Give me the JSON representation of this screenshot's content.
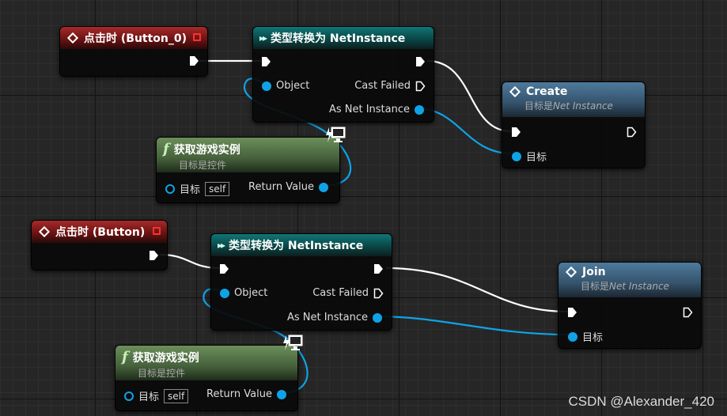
{
  "graph": {
    "group1": {
      "event_node": {
        "title": "点击时 (Button_0)"
      },
      "cast_node": {
        "title": "类型转换为 NetInstance",
        "object_pin": "Object",
        "cast_failed_pin": "Cast Failed",
        "as_pin": "As Net Instance"
      },
      "call_node": {
        "title": "Create",
        "subtitle_prefix": "目标是",
        "subtitle_class": "Net Instance",
        "target_pin": "目标"
      },
      "func_node": {
        "title": "获取游戏实例",
        "subtitle": "目标是控件",
        "target_pin": "目标",
        "self_value": "self",
        "return_pin": "Return Value"
      }
    },
    "group2": {
      "event_node": {
        "title": "点击时 (Button)"
      },
      "cast_node": {
        "title": "类型转换为 NetInstance",
        "object_pin": "Object",
        "cast_failed_pin": "Cast Failed",
        "as_pin": "As Net Instance"
      },
      "call_node": {
        "title": "Join",
        "subtitle_prefix": "目标是",
        "subtitle_class": "Net Instance",
        "target_pin": "目标"
      },
      "func_node": {
        "title": "获取游戏实例",
        "subtitle": "目标是控件",
        "target_pin": "目标",
        "self_value": "self",
        "return_pin": "Return Value"
      }
    }
  },
  "colors": {
    "exec_wire": "#ffffff",
    "data_wire": "#0fa3e6",
    "event_header": "#a62a2a",
    "cast_header": "#117676",
    "func_header": "#6b8e5a",
    "call_header": "#4e7a9c"
  },
  "watermark": "CSDN @Alexander_420"
}
